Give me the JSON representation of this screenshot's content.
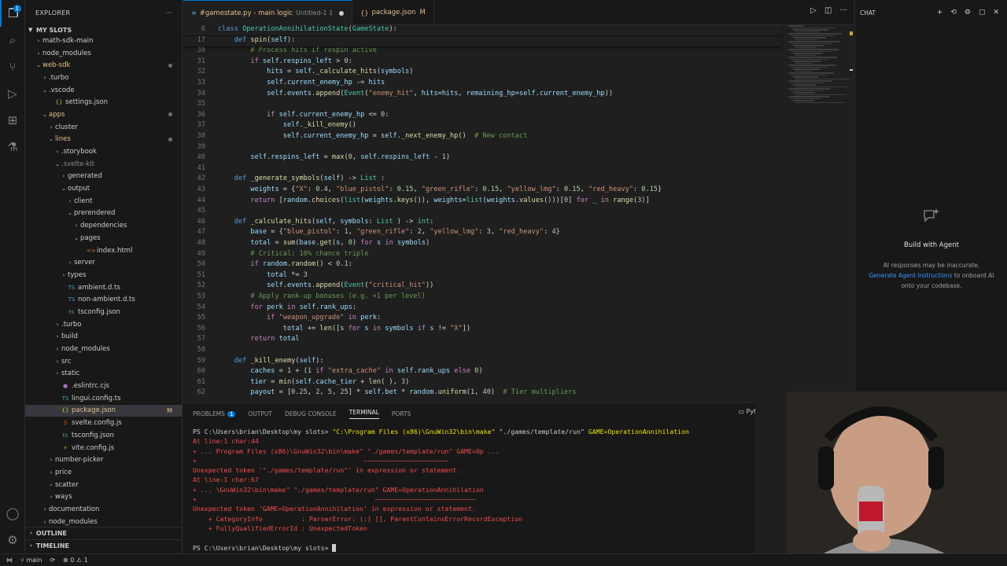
{
  "explorer": {
    "title": "EXPLORER",
    "section": "MY SLOTS",
    "items": [
      {
        "label": "math-sdk-main",
        "depth": 1,
        "kind": "folder",
        "open": false
      },
      {
        "label": "node_modules",
        "depth": 1,
        "kind": "folder",
        "open": false
      },
      {
        "label": "web-sdk",
        "depth": 1,
        "kind": "folder",
        "open": true,
        "color": "#e2c08d",
        "dot": true
      },
      {
        "label": ".turbo",
        "depth": 2,
        "kind": "folder",
        "open": false
      },
      {
        "label": ".vscode",
        "depth": 2,
        "kind": "folder",
        "open": true
      },
      {
        "label": "settings.json",
        "depth": 3,
        "kind": "json"
      },
      {
        "label": "apps",
        "depth": 2,
        "kind": "folder",
        "open": true,
        "color": "#e2c08d",
        "dot": true
      },
      {
        "label": "cluster",
        "depth": 3,
        "kind": "folder",
        "open": false
      },
      {
        "label": "lines",
        "depth": 3,
        "kind": "folder",
        "open": true,
        "color": "#e2c08d",
        "dot": true
      },
      {
        "label": ".storybook",
        "depth": 4,
        "kind": "folder",
        "open": false
      },
      {
        "label": ".svelte-kit",
        "depth": 4,
        "kind": "folder",
        "open": true,
        "color": "#8b8b8b"
      },
      {
        "label": "generated",
        "depth": 5,
        "kind": "folder",
        "open": false
      },
      {
        "label": "output",
        "depth": 5,
        "kind": "folder",
        "open": true
      },
      {
        "label": "client",
        "depth": 6,
        "kind": "folder",
        "open": false
      },
      {
        "label": "prerendered",
        "depth": 6,
        "kind": "folder",
        "open": true
      },
      {
        "label": "dependencies",
        "depth": 7,
        "kind": "folder",
        "open": false
      },
      {
        "label": "pages",
        "depth": 7,
        "kind": "folder",
        "open": true
      },
      {
        "label": "index.html",
        "depth": 8,
        "kind": "html"
      },
      {
        "label": "server",
        "depth": 6,
        "kind": "folder",
        "open": false
      },
      {
        "label": "types",
        "depth": 5,
        "kind": "folder",
        "open": false
      },
      {
        "label": "ambient.d.ts",
        "depth": 5,
        "kind": "ts"
      },
      {
        "label": "non-ambient.d.ts",
        "depth": 5,
        "kind": "ts"
      },
      {
        "label": "tsconfig.json",
        "depth": 5,
        "kind": "tsjson"
      },
      {
        "label": ".turbo",
        "depth": 4,
        "kind": "folder",
        "open": false
      },
      {
        "label": "build",
        "depth": 4,
        "kind": "folder",
        "open": false
      },
      {
        "label": "node_modules",
        "depth": 4,
        "kind": "folder",
        "open": false
      },
      {
        "label": "src",
        "depth": 4,
        "kind": "folder",
        "open": false
      },
      {
        "label": "static",
        "depth": 4,
        "kind": "folder",
        "open": false
      },
      {
        "label": ".eslintrc.cjs",
        "depth": 4,
        "kind": "eslint"
      },
      {
        "label": "lingui.config.ts",
        "depth": 4,
        "kind": "ts"
      },
      {
        "label": "package.json",
        "depth": 4,
        "kind": "json",
        "selected": true,
        "mod": "M",
        "color": "#e2c08d"
      },
      {
        "label": "svelte.config.js",
        "depth": 4,
        "kind": "svelte"
      },
      {
        "label": "tsconfig.json",
        "depth": 4,
        "kind": "tsjson"
      },
      {
        "label": "vite.config.js",
        "depth": 4,
        "kind": "vite"
      },
      {
        "label": "number-picker",
        "depth": 3,
        "kind": "folder",
        "open": false
      },
      {
        "label": "price",
        "depth": 3,
        "kind": "folder",
        "open": false
      },
      {
        "label": "scatter",
        "depth": 3,
        "kind": "folder",
        "open": false
      },
      {
        "label": "ways",
        "depth": 3,
        "kind": "folder",
        "open": false
      },
      {
        "label": "documentation",
        "depth": 2,
        "kind": "folder",
        "open": false
      },
      {
        "label": "node_modules",
        "depth": 2,
        "kind": "folder",
        "open": false
      }
    ],
    "outline": "OUTLINE",
    "timeline": "TIMELINE"
  },
  "tabs": [
    {
      "label": "#gamestate.py - main logic",
      "sub": "Untitled-1 1",
      "dirty": true,
      "active": true,
      "icon": "#"
    },
    {
      "label": "package.json",
      "mod": "M",
      "active": false,
      "icon": "{}"
    }
  ],
  "activity_badge": "1",
  "editor": {
    "lines": [
      {
        "n": "6",
        "sticky": true,
        "html": "<span class=\"kw\">class</span> <span class=\"cls\">OperationAnnihilationState</span>(<span class=\"cls\">GameState</span>):"
      },
      {
        "n": "17",
        "sticky": true,
        "html": "    <span class=\"kw\">def</span> <span class=\"fn\">spin</span>(<span class=\"var\">self</span>):"
      },
      {
        "n": "30",
        "html": "        <span class=\"cm\"># Process hits if respin active</span>"
      },
      {
        "n": "31",
        "html": "        <span class=\"kw2\">if</span> <span class=\"var\">self</span>.<span class=\"var\">respins_left</span> &gt; <span class=\"num\">0</span>:"
      },
      {
        "n": "32",
        "html": "            <span class=\"var\">hits</span> = <span class=\"var\">self</span>.<span class=\"fn\">_calculate_hits</span>(<span class=\"var\">symbols</span>)"
      },
      {
        "n": "33",
        "html": "            <span class=\"var\">self</span>.<span class=\"var\">current_enemy_hp</span> -= <span class=\"var\">hits</span>"
      },
      {
        "n": "34",
        "html": "            <span class=\"var\">self</span>.<span class=\"var\">events</span>.<span class=\"fn\">append</span>(<span class=\"cls\">Event</span>(<span class=\"str\">\"enemy_hit\"</span>, <span class=\"var\">hits</span>=<span class=\"var\">hits</span>, <span class=\"var\">remaining_hp</span>=<span class=\"var\">self</span>.<span class=\"var\">current_enemy_hp</span>))"
      },
      {
        "n": "35",
        "html": ""
      },
      {
        "n": "36",
        "html": "            <span class=\"kw2\">if</span> <span class=\"var\">self</span>.<span class=\"var\">current_enemy_hp</span> &lt;= <span class=\"num\">0</span>:"
      },
      {
        "n": "37",
        "html": "                <span class=\"var\">self</span>.<span class=\"fn\">_kill_enemy</span>()"
      },
      {
        "n": "38",
        "html": "                <span class=\"var\">self</span>.<span class=\"var\">current_enemy_hp</span> = <span class=\"var\">self</span>.<span class=\"fn\">_next_enemy_hp</span>()  <span class=\"cm\"># New contact</span>"
      },
      {
        "n": "39",
        "html": ""
      },
      {
        "n": "40",
        "html": "        <span class=\"var\">self</span>.<span class=\"var\">respins_left</span> = <span class=\"fn\">max</span>(<span class=\"num\">0</span>, <span class=\"var\">self</span>.<span class=\"var\">respins_left</span> - <span class=\"num\">1</span>)"
      },
      {
        "n": "41",
        "html": ""
      },
      {
        "n": "42",
        "html": "    <span class=\"kw\">def</span> <span class=\"fn\">_generate_symbols</span>(<span class=\"var\">self</span>) -&gt; <span class=\"cls\">List</span> :"
      },
      {
        "n": "43",
        "html": "        <span class=\"var\">weights</span> = {<span class=\"str\">\"X\"</span>: <span class=\"num\">0.4</span>, <span class=\"str\">\"blue_pistol\"</span>: <span class=\"num\">0.15</span>, <span class=\"str\">\"green_rifle\"</span>: <span class=\"num\">0.15</span>, <span class=\"str\">\"yellow_lmg\"</span>: <span class=\"num\">0.15</span>, <span class=\"str\">\"red_heavy\"</span>: <span class=\"num\">0.15</span>}"
      },
      {
        "n": "44",
        "html": "        <span class=\"kw2\">return</span> [<span class=\"var\">random</span>.<span class=\"fn\">choices</span>(<span class=\"cls\">list</span>(<span class=\"var\">weights</span>.<span class=\"fn\">keys</span>()), <span class=\"var\">weights</span>=<span class=\"cls\">list</span>(<span class=\"var\">weights</span>.<span class=\"fn\">values</span>()))[<span class=\"num\">0</span>] <span class=\"kw2\">for</span> <span class=\"var\">_</span> <span class=\"kw2\">in</span> <span class=\"fn\">range</span>(<span class=\"num\">3</span>)]"
      },
      {
        "n": "45",
        "html": ""
      },
      {
        "n": "46",
        "html": "    <span class=\"kw\">def</span> <span class=\"fn\">_calculate_hits</span>(<span class=\"var\">self</span>, <span class=\"var\">symbols</span>: <span class=\"cls\">List</span> ) -&gt; <span class=\"cls\">int</span>:"
      },
      {
        "n": "47",
        "html": "        <span class=\"var\">base</span> = {<span class=\"str\">\"blue_pistol\"</span>: <span class=\"num\">1</span>, <span class=\"str\">\"green_rifle\"</span>: <span class=\"num\">2</span>, <span class=\"str\">\"yellow_lmg\"</span>: <span class=\"num\">3</span>, <span class=\"str\">\"red_heavy\"</span>: <span class=\"num\">4</span>}"
      },
      {
        "n": "48",
        "html": "        <span class=\"var\">total</span> = <span class=\"fn\">sum</span>(<span class=\"var\">base</span>.<span class=\"fn\">get</span>(<span class=\"var\">s</span>, <span class=\"num\">0</span>) <span class=\"kw2\">for</span> <span class=\"var\">s</span> <span class=\"kw2\">in</span> <span class=\"var\">symbols</span>)"
      },
      {
        "n": "49",
        "html": "        <span class=\"cm\"># Critical: 10% chance triple</span>"
      },
      {
        "n": "50",
        "html": "        <span class=\"kw2\">if</span> <span class=\"var\">random</span>.<span class=\"fn\">random</span>() &lt; <span class=\"num\">0.1</span>:"
      },
      {
        "n": "51",
        "html": "            <span class=\"var\">total</span> *= <span class=\"num\">3</span>"
      },
      {
        "n": "52",
        "html": "            <span class=\"var\">self</span>.<span class=\"var\">events</span>.<span class=\"fn\">append</span>(<span class=\"cls\">Event</span>(<span class=\"str\">\"critical_hit\"</span>))"
      },
      {
        "n": "53",
        "html": "        <span class=\"cm\"># Apply rank-up bonuses (e.g. +1 per level)</span>"
      },
      {
        "n": "54",
        "html": "        <span class=\"kw2\">for</span> <span class=\"var\">perk</span> <span class=\"kw2\">in</span> <span class=\"var\">self</span>.<span class=\"var\">rank_ups</span>:"
      },
      {
        "n": "55",
        "html": "            <span class=\"kw2\">if</span> <span class=\"str\">\"weapon_upgrade\"</span> <span class=\"kw2\">in</span> <span class=\"var\">perk</span>:"
      },
      {
        "n": "56",
        "html": "                <span class=\"var\">total</span> += <span class=\"fn\">len</span>([<span class=\"var\">s</span> <span class=\"kw2\">for</span> <span class=\"var\">s</span> <span class=\"kw2\">in</span> <span class=\"var\">symbols</span> <span class=\"kw2\">if</span> <span class=\"var\">s</span> != <span class=\"str\">\"X\"</span>])"
      },
      {
        "n": "57",
        "html": "        <span class=\"kw2\">return</span> <span class=\"var\">total</span>"
      },
      {
        "n": "58",
        "html": ""
      },
      {
        "n": "59",
        "html": "    <span class=\"kw\">def</span> <span class=\"fn\">_kill_enemy</span>(<span class=\"var\">self</span>):"
      },
      {
        "n": "60",
        "html": "        <span class=\"var\">caches</span> = <span class=\"num\">1</span> + (<span class=\"num\">1</span> <span class=\"kw2\">if</span> <span class=\"str\">\"extra_cache\"</span> <span class=\"kw2\">in</span> <span class=\"var\">self</span>.<span class=\"var\">rank_ups</span> <span class=\"kw2\">else</span> <span class=\"num\">0</span>)"
      },
      {
        "n": "61",
        "html": "        <span class=\"var\">tier</span> = <span class=\"fn\">min</span>(<span class=\"var\">self</span>.<span class=\"var\">cache_tier</span> + <span class=\"fn\">len</span>( ), <span class=\"num\">3</span>)"
      },
      {
        "n": "62",
        "html": "        <span class=\"var\">payout</span> = [<span class=\"num\">0.25</span>, <span class=\"num\">2</span>, <span class=\"num\">5</span>, <span class=\"num\">25</span>] * <span class=\"var\">self</span>.<span class=\"var\">bet</span> * <span class=\"var\">random</span>.<span class=\"fn\">uniform</span>(<span class=\"num\">1</span>, <span class=\"num\">40</span>)  <span class=\"cm\"># Tier multipliers</span>"
      }
    ]
  },
  "panel": {
    "tabs": [
      {
        "label": "PROBLEMS",
        "badge": "1"
      },
      {
        "label": "OUTPUT"
      },
      {
        "label": "DEBUG CONSOLE"
      },
      {
        "label": "TERMINAL",
        "active": true
      },
      {
        "label": "PORTS"
      }
    ],
    "shell": "Python",
    "terminal": [
      {
        "type": "prompt",
        "prompt": "PS C:\\Users\\brian\\Desktop\\my slots> ",
        "cmd": "\"C:\\Program Files (x86)\\GnuWin32\\bin\\make\"",
        "args": " \"./games/template/run\" ",
        "tail": "GAME=OperationAnnihilation"
      },
      {
        "type": "err",
        "text": "At line:1 char:44"
      },
      {
        "type": "err",
        "text": "+ ... Program Files (x86)\\GnuWin32\\bin\\make\" \"./games/template/run\" GAME=Op ..."
      },
      {
        "type": "err",
        "text": "+                                           ~~~~~~~~~~~~~~~~~~~~~~"
      },
      {
        "type": "err",
        "text": "Unexpected token '\"./games/template/run\"' in expression or statement."
      },
      {
        "type": "err",
        "text": "At line:1 char:67"
      },
      {
        "type": "err",
        "text": "+ ... \\GnuWin32\\bin\\make\" \"./games/template/run\" GAME=OperationAnnihilation"
      },
      {
        "type": "err",
        "text": "+                                              ~~~~~~~~~~~~~~~~~~~~~~~~~~"
      },
      {
        "type": "err",
        "text": "Unexpected token 'GAME=OperationAnnihilation' in expression or statement."
      },
      {
        "type": "err",
        "text": "    + CategoryInfo          : ParserError: (:) [], ParentContainsErrorRecordException"
      },
      {
        "type": "err",
        "text": "    + FullyQualifiedErrorId : UnexpectedToken"
      },
      {
        "type": "blank",
        "text": ""
      },
      {
        "type": "prompt_end",
        "prompt": "PS C:\\Users\\brian\\Desktop\\my slots> "
      }
    ]
  },
  "chat": {
    "header": "CHAT",
    "title": "Build with Agent",
    "desc1": "AI responses may be inaccurate.",
    "link": "Generate Agent Instructions",
    "desc2": " to onboard AI onto your codebase."
  },
  "status": {
    "branch": "main",
    "errors": "0",
    "warnings": "1"
  }
}
